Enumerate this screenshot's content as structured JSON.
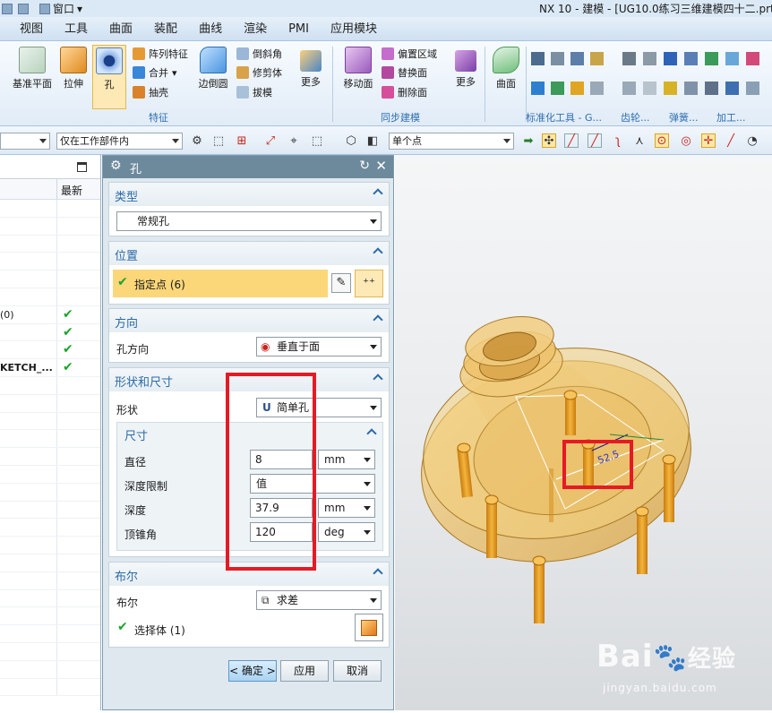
{
  "window": {
    "title": "NX 10 - 建模 - [UG10.0练习三维建模四十二.prt"
  },
  "quick_access": {
    "window_menu": "窗口"
  },
  "menu": {
    "items": [
      "视图",
      "工具",
      "曲面",
      "装配",
      "曲线",
      "渲染",
      "PMI",
      "应用模块"
    ]
  },
  "ribbon": {
    "large_buttons": [
      "基准平面",
      "拉伸",
      "孔",
      "边倒圆",
      "更多",
      "移动面",
      "更多",
      "曲面"
    ],
    "small_buttons": [
      "阵列特征",
      "合并",
      "抽壳",
      "倒斜角",
      "修剪体",
      "拔模",
      "偏置区域",
      "替换面",
      "删除面"
    ],
    "groups": [
      "特征",
      "同步建模",
      "标准化工具 - G...",
      "齿轮...",
      "弹簧...",
      "加工..."
    ]
  },
  "toolbar2": {
    "filter_left": "",
    "scope": "仅在工作部件内",
    "snap": "单个点"
  },
  "navigator": {
    "column_latest": "最新",
    "rows": [
      {
        "label": "",
        "check": false
      },
      {
        "label": "",
        "check": false
      },
      {
        "label": "",
        "check": false
      },
      {
        "label": "",
        "check": false
      },
      {
        "label": "",
        "check": false
      },
      {
        "label": "",
        "check": false
      },
      {
        "label": "(0)",
        "check": true
      },
      {
        "label": "",
        "check": true
      },
      {
        "label": "",
        "check": true
      },
      {
        "label": "KETCH_...",
        "check": true,
        "bold": true
      },
      {
        "label": "",
        "check": false
      },
      {
        "label": "",
        "check": false
      },
      {
        "label": "",
        "check": false
      },
      {
        "label": "",
        "check": false
      },
      {
        "label": "",
        "check": false
      },
      {
        "label": "",
        "check": false
      },
      {
        "label": "",
        "check": false
      },
      {
        "label": "",
        "check": false
      },
      {
        "label": "",
        "check": false
      },
      {
        "label": "",
        "check": false
      },
      {
        "label": "",
        "check": false
      },
      {
        "label": "",
        "check": false
      },
      {
        "label": "",
        "check": false
      },
      {
        "label": "",
        "check": false
      },
      {
        "label": "",
        "check": false
      },
      {
        "label": "",
        "check": false
      },
      {
        "label": "",
        "check": false
      },
      {
        "label": "",
        "check": false
      }
    ]
  },
  "dialog": {
    "title": "孔",
    "type": {
      "header": "类型",
      "value": "常规孔"
    },
    "position": {
      "header": "位置",
      "specify_point": "指定点 (6)"
    },
    "direction": {
      "header": "方向",
      "label": "孔方向",
      "value": "垂直于面"
    },
    "shape": {
      "header": "形状和尺寸",
      "shape_label": "形状",
      "shape_value": "简单孔",
      "dims_header": "尺寸",
      "diameter_label": "直径",
      "diameter_value": "8",
      "diameter_unit": "mm",
      "depth_limit_label": "深度限制",
      "depth_limit_value": "值",
      "depth_label": "深度",
      "depth_value": "37.9",
      "depth_unit": "mm",
      "tip_angle_label": "顶锥角",
      "tip_angle_value": "120",
      "tip_angle_unit": "deg"
    },
    "boolean": {
      "header": "布尔",
      "label": "布尔",
      "value": "求差",
      "select_body": "选择体 (1)"
    },
    "buttons": {
      "ok": "< 确定 >",
      "apply": "应用",
      "cancel": "取消"
    }
  },
  "viewport": {
    "dimension_label": "52.5"
  },
  "watermark": {
    "brand": "Bai",
    "brand_cn": "经验",
    "url": "jingyan.baidu.com"
  },
  "colors": {
    "accent": "#2c6aa6",
    "highlight_row": "#fbd77a",
    "red_box": "#e51a24",
    "model_orange": "#e8a935"
  }
}
